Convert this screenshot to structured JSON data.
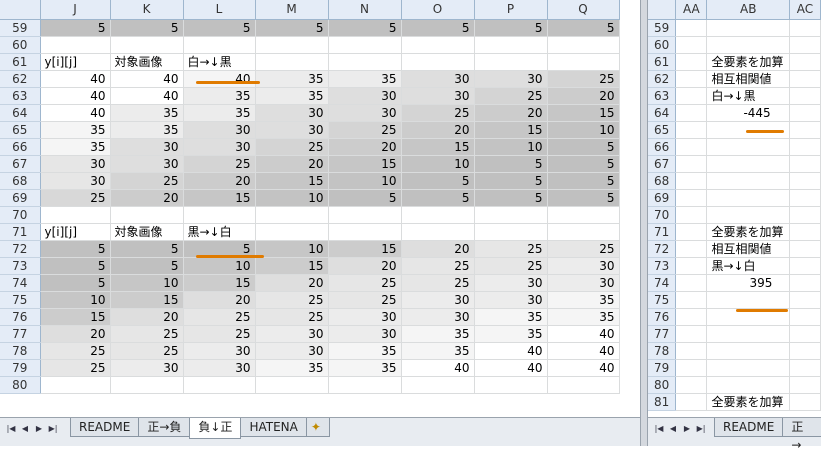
{
  "left_pane": {
    "columns": [
      "J",
      "K",
      "L",
      "M",
      "N",
      "O",
      "P",
      "Q"
    ],
    "rows": [
      {
        "num": "59",
        "cells": [
          "5",
          "5",
          "5",
          "5",
          "5",
          "5",
          "5",
          "5"
        ],
        "shade": "#c0c0c0"
      },
      {
        "num": "60",
        "cells": [
          "",
          "",
          "",
          "",
          "",
          "",
          "",
          ""
        ],
        "shade": "#ffffff"
      },
      {
        "num": "61",
        "cells": [
          "y[i][j]",
          "対象画像",
          "白→↓黒",
          "",
          "",
          "",
          "",
          ""
        ],
        "shade": "#ffffff",
        "text": true
      },
      {
        "num": "62",
        "cells": [
          "40",
          "40",
          "40",
          "35",
          "35",
          "30",
          "30",
          "25"
        ],
        "shades": [
          "#ffffff",
          "#ffffff",
          "#f5f5f5",
          "#ececec",
          "#ececec",
          "#dedede",
          "#dedede",
          "#d4d4d4"
        ]
      },
      {
        "num": "63",
        "cells": [
          "40",
          "40",
          "35",
          "35",
          "30",
          "30",
          "25",
          "20"
        ],
        "shades": [
          "#ffffff",
          "#ffffff",
          "#ececec",
          "#ececec",
          "#dedede",
          "#dedede",
          "#d4d4d4",
          "#cccccc"
        ]
      },
      {
        "num": "64",
        "cells": [
          "40",
          "35",
          "35",
          "30",
          "30",
          "25",
          "20",
          "15"
        ],
        "shades": [
          "#ffffff",
          "#ececec",
          "#ececec",
          "#dedede",
          "#dedede",
          "#d4d4d4",
          "#cccccc",
          "#c6c6c6"
        ]
      },
      {
        "num": "65",
        "cells": [
          "35",
          "35",
          "30",
          "30",
          "25",
          "20",
          "15",
          "10"
        ],
        "shades": [
          "#f5f5f5",
          "#ececec",
          "#dedede",
          "#dedede",
          "#d4d4d4",
          "#cccccc",
          "#c6c6c6",
          "#c3c3c3"
        ]
      },
      {
        "num": "66",
        "cells": [
          "35",
          "30",
          "30",
          "25",
          "20",
          "15",
          "10",
          "5"
        ],
        "shades": [
          "#f5f5f5",
          "#dedede",
          "#dedede",
          "#d4d4d4",
          "#cccccc",
          "#c6c6c6",
          "#c3c3c3",
          "#c0c0c0"
        ]
      },
      {
        "num": "67",
        "cells": [
          "30",
          "30",
          "25",
          "20",
          "15",
          "10",
          "5",
          "5"
        ],
        "shades": [
          "#e6e6e6",
          "#dedede",
          "#d4d4d4",
          "#cccccc",
          "#c6c6c6",
          "#c3c3c3",
          "#c0c0c0",
          "#c0c0c0"
        ]
      },
      {
        "num": "68",
        "cells": [
          "30",
          "25",
          "20",
          "15",
          "10",
          "5",
          "5",
          "5"
        ],
        "shades": [
          "#e6e6e6",
          "#d4d4d4",
          "#cccccc",
          "#c6c6c6",
          "#c3c3c3",
          "#c0c0c0",
          "#c0c0c0",
          "#c0c0c0"
        ]
      },
      {
        "num": "69",
        "cells": [
          "25",
          "20",
          "15",
          "10",
          "5",
          "5",
          "5",
          "5"
        ],
        "shades": [
          "#d8d8d8",
          "#cccccc",
          "#c6c6c6",
          "#c3c3c3",
          "#c0c0c0",
          "#c0c0c0",
          "#c0c0c0",
          "#c0c0c0"
        ]
      },
      {
        "num": "70",
        "cells": [
          "",
          "",
          "",
          "",
          "",
          "",
          "",
          ""
        ],
        "shade": "#ffffff"
      },
      {
        "num": "71",
        "cells": [
          "y[i][j]",
          "対象画像",
          "黒→↓白",
          "",
          "",
          "",
          "",
          ""
        ],
        "shade": "#ffffff",
        "text": true
      },
      {
        "num": "72",
        "cells": [
          "5",
          "5",
          "5",
          "10",
          "15",
          "20",
          "25",
          "25"
        ],
        "shades": [
          "#c0c0c0",
          "#c0c0c0",
          "#c0c0c0",
          "#c6c6c6",
          "#cccccc",
          "#dedede",
          "#e6e6e6",
          "#e6e6e6"
        ]
      },
      {
        "num": "73",
        "cells": [
          "5",
          "5",
          "10",
          "15",
          "20",
          "25",
          "25",
          "30"
        ],
        "shades": [
          "#c0c0c0",
          "#c0c0c0",
          "#c6c6c6",
          "#cccccc",
          "#dedede",
          "#e6e6e6",
          "#e6e6e6",
          "#ececec"
        ]
      },
      {
        "num": "74",
        "cells": [
          "5",
          "10",
          "15",
          "20",
          "25",
          "25",
          "30",
          "30"
        ],
        "shades": [
          "#c0c0c0",
          "#c6c6c6",
          "#cccccc",
          "#dedede",
          "#e6e6e6",
          "#e6e6e6",
          "#ececec",
          "#ececec"
        ]
      },
      {
        "num": "75",
        "cells": [
          "10",
          "15",
          "20",
          "25",
          "25",
          "30",
          "30",
          "35"
        ],
        "shades": [
          "#c6c6c6",
          "#cccccc",
          "#dedede",
          "#e6e6e6",
          "#e6e6e6",
          "#ececec",
          "#ececec",
          "#f5f5f5"
        ]
      },
      {
        "num": "76",
        "cells": [
          "15",
          "20",
          "25",
          "25",
          "30",
          "30",
          "35",
          "35"
        ],
        "shades": [
          "#cccccc",
          "#dedede",
          "#e6e6e6",
          "#e6e6e6",
          "#ececec",
          "#ececec",
          "#f5f5f5",
          "#f5f5f5"
        ]
      },
      {
        "num": "77",
        "cells": [
          "20",
          "25",
          "25",
          "30",
          "30",
          "35",
          "35",
          "40"
        ],
        "shades": [
          "#dedede",
          "#e6e6e6",
          "#e6e6e6",
          "#ececec",
          "#ececec",
          "#f5f5f5",
          "#f5f5f5",
          "#ffffff"
        ]
      },
      {
        "num": "78",
        "cells": [
          "25",
          "25",
          "30",
          "30",
          "35",
          "35",
          "40",
          "40"
        ],
        "shades": [
          "#e6e6e6",
          "#e6e6e6",
          "#ececec",
          "#ececec",
          "#f5f5f5",
          "#f5f5f5",
          "#ffffff",
          "#ffffff"
        ]
      },
      {
        "num": "79",
        "cells": [
          "25",
          "30",
          "30",
          "35",
          "35",
          "40",
          "40",
          "40"
        ],
        "shades": [
          "#e6e6e6",
          "#ececec",
          "#ececec",
          "#f5f5f5",
          "#f5f5f5",
          "#ffffff",
          "#ffffff",
          "#ffffff"
        ]
      },
      {
        "num": "80",
        "cells": [
          "",
          "",
          "",
          "",
          "",
          "",
          "",
          ""
        ],
        "shade": "#ffffff"
      }
    ]
  },
  "right_pane": {
    "columns": [
      "AA",
      "AB",
      "AC"
    ],
    "rows": [
      {
        "num": "59",
        "text": ""
      },
      {
        "num": "60",
        "text": ""
      },
      {
        "num": "61",
        "text": "全要素を加算"
      },
      {
        "num": "62",
        "text": "相互相関値"
      },
      {
        "num": "63",
        "text": "白→↓黒"
      },
      {
        "num": "64",
        "text": "-445",
        "value": true
      },
      {
        "num": "65",
        "text": ""
      },
      {
        "num": "66",
        "text": ""
      },
      {
        "num": "67",
        "text": ""
      },
      {
        "num": "68",
        "text": ""
      },
      {
        "num": "69",
        "text": ""
      },
      {
        "num": "70",
        "text": ""
      },
      {
        "num": "71",
        "text": "全要素を加算"
      },
      {
        "num": "72",
        "text": "相互相関値"
      },
      {
        "num": "73",
        "text": "黒→↓白"
      },
      {
        "num": "74",
        "text": "395",
        "value": true
      },
      {
        "num": "75",
        "text": ""
      },
      {
        "num": "76",
        "text": ""
      },
      {
        "num": "77",
        "text": ""
      },
      {
        "num": "78",
        "text": ""
      },
      {
        "num": "79",
        "text": ""
      },
      {
        "num": "80",
        "text": ""
      },
      {
        "num": "81",
        "text": "全要素を加算"
      }
    ]
  },
  "tabs_left": [
    "README",
    "正→負",
    "負↓正",
    "HATENA"
  ],
  "active_tab": "負↓正",
  "tabs_right": [
    "README",
    "正→"
  ],
  "underline_color": "#e07b00"
}
